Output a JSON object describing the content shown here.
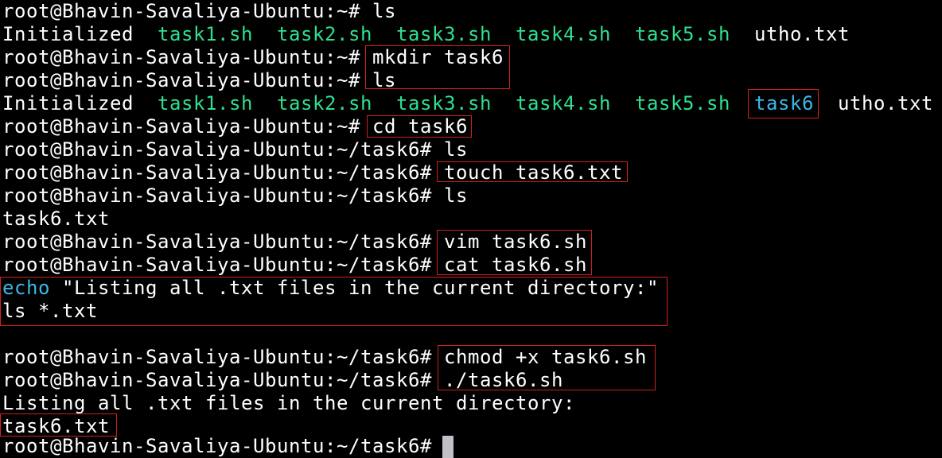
{
  "prompt_home": "root@Bhavin-Savaliya-Ubuntu:~# ",
  "prompt_task6": "root@Bhavin-Savaliya-Ubuntu:~/task6# ",
  "sep": "  ",
  "files": {
    "initialized": "Initialized",
    "task1": "task1.sh",
    "task2": "task2.sh",
    "task3": "task3.sh",
    "task4": "task4.sh",
    "task5": "task5.sh",
    "task6": "task6",
    "utho": "utho.txt"
  },
  "commands": {
    "ls": "ls",
    "mkdir": "mkdir task6",
    "cd": "cd task6",
    "touch": "touch task6.txt",
    "vim": "vim task6.sh",
    "cat": "cat task6.sh",
    "chmod": "chmod +x task6.sh",
    "run": "./task6.sh"
  },
  "script_content": {
    "echo_keyword": "echo",
    "echo_rest": " \"Listing all .txt files in the current directory:\"",
    "ls_line": "ls *.txt"
  },
  "outputs": {
    "task6_txt": "task6.txt",
    "listing": "Listing all .txt files in the current directory:"
  },
  "colors": {
    "background": "#000000",
    "text": "#ffffff",
    "executable": "#2ee08f",
    "directory": "#3bb8e8",
    "highlight_box": "#d21f1f"
  }
}
